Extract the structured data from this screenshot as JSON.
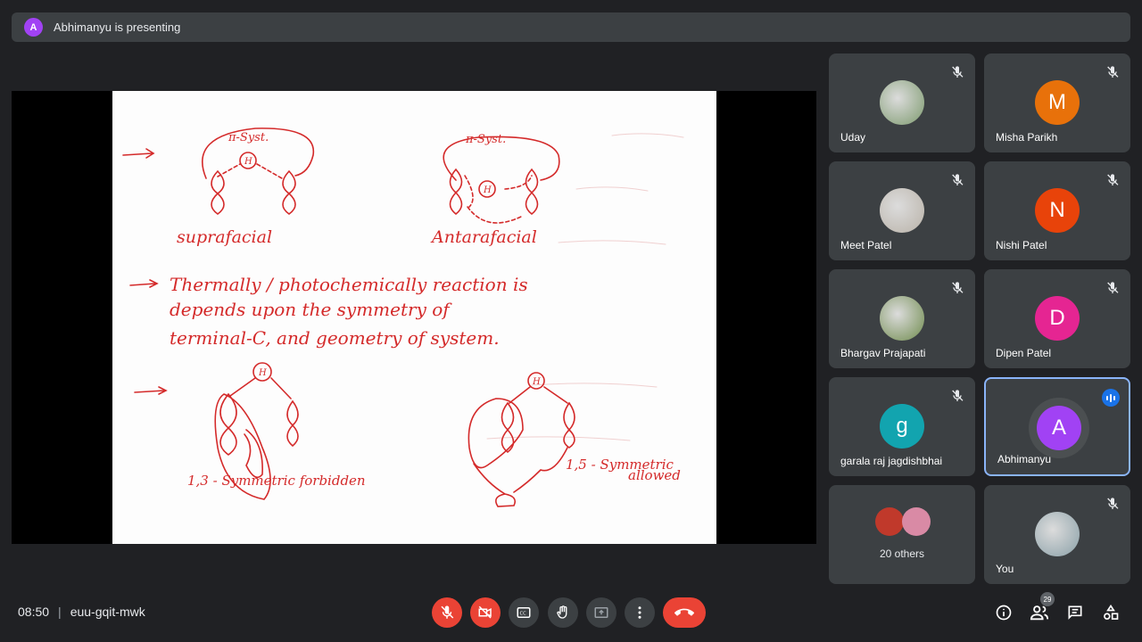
{
  "banner": {
    "avatar_letter": "A",
    "text": "Abhimanyu is presenting"
  },
  "meeting": {
    "time": "08:50",
    "code": "euu-gqit-mwk"
  },
  "slide": {
    "pi_left": "π-Syst.",
    "pi_right": "π-Syst.",
    "label_supra": "suprafacial",
    "label_antara": "Antarafacial",
    "line1": "Thermally / photochemically reaction is",
    "line2": "depends upon the symmetry of",
    "line3": "terminal-C, and geometry of system.",
    "label_forbidden": "1,3 - Symmetric forbidden",
    "label_allowed_1": "1,5 - Symmetric",
    "label_allowed_2": "allowed",
    "h_label": "H"
  },
  "participants": [
    {
      "name": "Uday",
      "avatar_type": "photo",
      "avatar_color": "#7d9a6e",
      "muted": true
    },
    {
      "name": "Misha Parikh",
      "avatar_type": "letter",
      "letter": "M",
      "avatar_color": "#e8710a",
      "muted": true
    },
    {
      "name": "Meet Patel",
      "avatar_type": "photo",
      "avatar_color": "#b9b2a8",
      "muted": true
    },
    {
      "name": "Nishi Patel",
      "avatar_type": "letter",
      "letter": "N",
      "avatar_color": "#e8430a",
      "muted": true
    },
    {
      "name": "Bhargav Prajapati",
      "avatar_type": "photo",
      "avatar_color": "#6f8b4d",
      "muted": true
    },
    {
      "name": "Dipen Patel",
      "avatar_type": "letter",
      "letter": "D",
      "avatar_color": "#e52592",
      "muted": true
    },
    {
      "name": "garala raj jagdishbhai",
      "avatar_type": "letter",
      "letter": "g",
      "avatar_color": "#12a4af",
      "muted": true
    },
    {
      "name": "Abhimanyu",
      "avatar_type": "letter",
      "letter": "A",
      "avatar_color": "#a142f4",
      "muted": false,
      "speaking": true
    },
    {
      "name": "20 others",
      "avatar_type": "group",
      "muted": false
    },
    {
      "name": "You",
      "avatar_type": "photo",
      "avatar_color": "#8aa0a8",
      "muted": true
    }
  ],
  "controls": {
    "people_count": "29",
    "icons": [
      "mic-off-icon",
      "camera-off-icon",
      "captions-icon",
      "raise-hand-icon",
      "present-icon",
      "more-options-icon",
      "end-call-icon"
    ],
    "right_icons": [
      "info-icon",
      "people-icon",
      "chat-icon",
      "activities-icon"
    ]
  },
  "colors": {
    "background": "#202124",
    "tile": "#3c4043",
    "danger": "#ea4335",
    "accent": "#8ab4f8",
    "ink": "#d42a2a"
  }
}
